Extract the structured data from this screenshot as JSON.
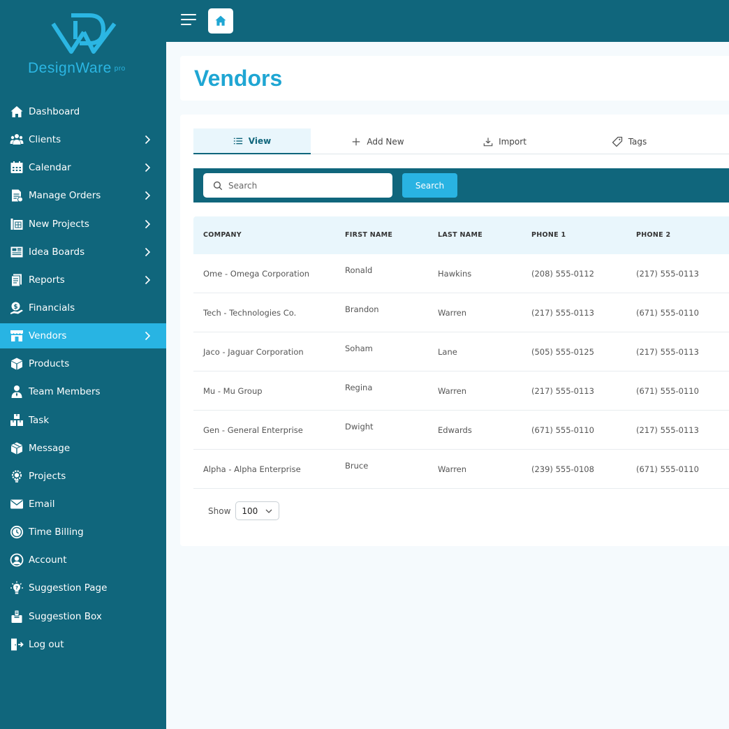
{
  "brand": {
    "name": "DesignWare",
    "suffix": "pro",
    "accent": "#28b4e3",
    "primary": "#10667c"
  },
  "sidebar": {
    "items": [
      {
        "label": "Dashboard",
        "icon": "home-icon",
        "chevron": false,
        "active": false
      },
      {
        "label": "Clients",
        "icon": "users-icon",
        "chevron": true,
        "active": false
      },
      {
        "label": "Calendar",
        "icon": "calendar-icon",
        "chevron": true,
        "active": false
      },
      {
        "label": "Manage Orders",
        "icon": "orders-icon",
        "chevron": true,
        "active": false
      },
      {
        "label": "New Projects",
        "icon": "blueprint-icon",
        "chevron": true,
        "active": false
      },
      {
        "label": "Idea Boards",
        "icon": "board-icon",
        "chevron": true,
        "active": false
      },
      {
        "label": "Reports",
        "icon": "report-icon",
        "chevron": true,
        "active": false
      },
      {
        "label": "Financials",
        "icon": "financials-icon",
        "chevron": false,
        "active": false
      },
      {
        "label": "Vendors",
        "icon": "store-icon",
        "chevron": true,
        "active": true
      },
      {
        "label": "Products",
        "icon": "box-icon",
        "chevron": false,
        "active": false
      },
      {
        "label": "Team Members",
        "icon": "person-icon",
        "chevron": false,
        "active": false
      },
      {
        "label": "Task",
        "icon": "boxes-icon",
        "chevron": false,
        "active": false
      },
      {
        "label": "Message",
        "icon": "message-box-icon",
        "chevron": false,
        "active": false
      },
      {
        "label": "Projects",
        "icon": "lightbulb-gear-icon",
        "chevron": false,
        "active": false
      },
      {
        "label": "Email",
        "icon": "envelope-icon",
        "chevron": false,
        "active": false
      },
      {
        "label": "Time Billing",
        "icon": "clock-icon",
        "chevron": false,
        "active": false
      },
      {
        "label": "Account",
        "icon": "account-circle-icon",
        "chevron": false,
        "active": false
      },
      {
        "label": "Suggestion Page",
        "icon": "idea-icon",
        "chevron": false,
        "active": false
      },
      {
        "label": "Suggestion Box",
        "icon": "suggestion-box-icon",
        "chevron": false,
        "active": false
      },
      {
        "label": "Log out",
        "icon": "logout-icon",
        "chevron": false,
        "active": false
      }
    ]
  },
  "page": {
    "title": "Vendors"
  },
  "tabs": [
    {
      "label": "View",
      "icon": "list-icon"
    },
    {
      "label": "Add New",
      "icon": "plus-icon"
    },
    {
      "label": "Import",
      "icon": "download-icon"
    },
    {
      "label": "Tags",
      "icon": "tag-icon"
    }
  ],
  "search": {
    "placeholder": "Search",
    "button_label": "Search"
  },
  "table": {
    "columns": [
      "COMPANY",
      "FIRST NAME",
      "LAST NAME",
      "PHONE 1",
      "PHONE 2"
    ],
    "rows": [
      [
        "Ome - Omega Corporation",
        "Ronald",
        "Hawkins",
        "(208) 555-0112",
        "(217) 555-0113"
      ],
      [
        "Tech - Technologies Co.",
        "Brandon",
        "Warren",
        "(217) 555-0113",
        "(671) 555-0110"
      ],
      [
        "Jaco - Jaguar Corporation",
        "Soham",
        "Lane",
        "(505) 555-0125",
        "(217) 555-0113"
      ],
      [
        "Mu - Mu Group",
        "Regina",
        "Warren",
        "(217) 555-0113",
        "(671) 555-0110"
      ],
      [
        "Gen - General Enterprise",
        "Dwight",
        "Edwards",
        "(671) 555-0110",
        "(217) 555-0113"
      ],
      [
        "Alpha - Alpha Enterprise",
        "Bruce",
        "Warren",
        "(239) 555-0108",
        "(671) 555-0110"
      ]
    ]
  },
  "pagination": {
    "show_label": "Show",
    "page_size": "100"
  }
}
